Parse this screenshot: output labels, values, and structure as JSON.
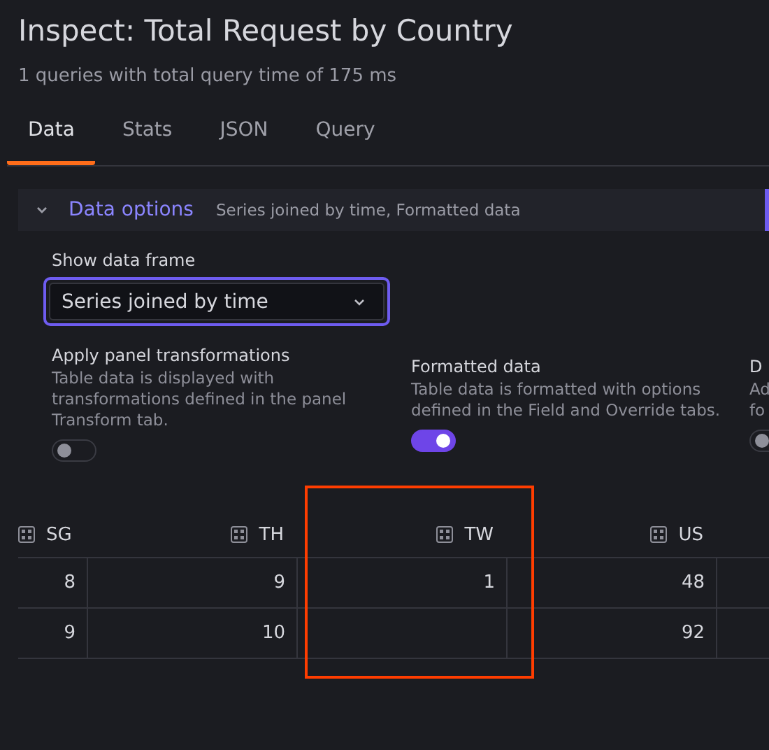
{
  "title": "Inspect: Total Request by Country",
  "subtitle": "1 queries with total query time of 175 ms",
  "tabs": [
    {
      "label": "Data",
      "selected": true
    },
    {
      "label": "Stats",
      "selected": false
    },
    {
      "label": "JSON",
      "selected": false
    },
    {
      "label": "Query",
      "selected": false
    }
  ],
  "data_options": {
    "title": "Data options",
    "summary": "Series joined by time, Formatted data",
    "expanded": true
  },
  "show_data_frame": {
    "label": "Show data frame",
    "value": "Series joined by time"
  },
  "options": [
    {
      "title": "Apply panel transformations",
      "description": [
        "Table data is displayed with",
        "transformations defined in the panel",
        "Transform tab."
      ],
      "on": false
    },
    {
      "title": "Formatted data",
      "description": [
        "Table data is formatted with options",
        "defined in the Field and Override tabs."
      ],
      "on": true
    },
    {
      "title": "D",
      "description": [
        "Ad",
        "fo"
      ],
      "on": false
    }
  ],
  "table": {
    "columns": [
      {
        "label": "SG",
        "highlighted": false
      },
      {
        "label": "TH",
        "highlighted": false
      },
      {
        "label": "TW",
        "highlighted": true
      },
      {
        "label": "US",
        "highlighted": false
      }
    ],
    "rows": [
      [
        "8",
        "9",
        "1",
        "48"
      ],
      [
        "9",
        "10",
        null,
        "92"
      ]
    ]
  }
}
